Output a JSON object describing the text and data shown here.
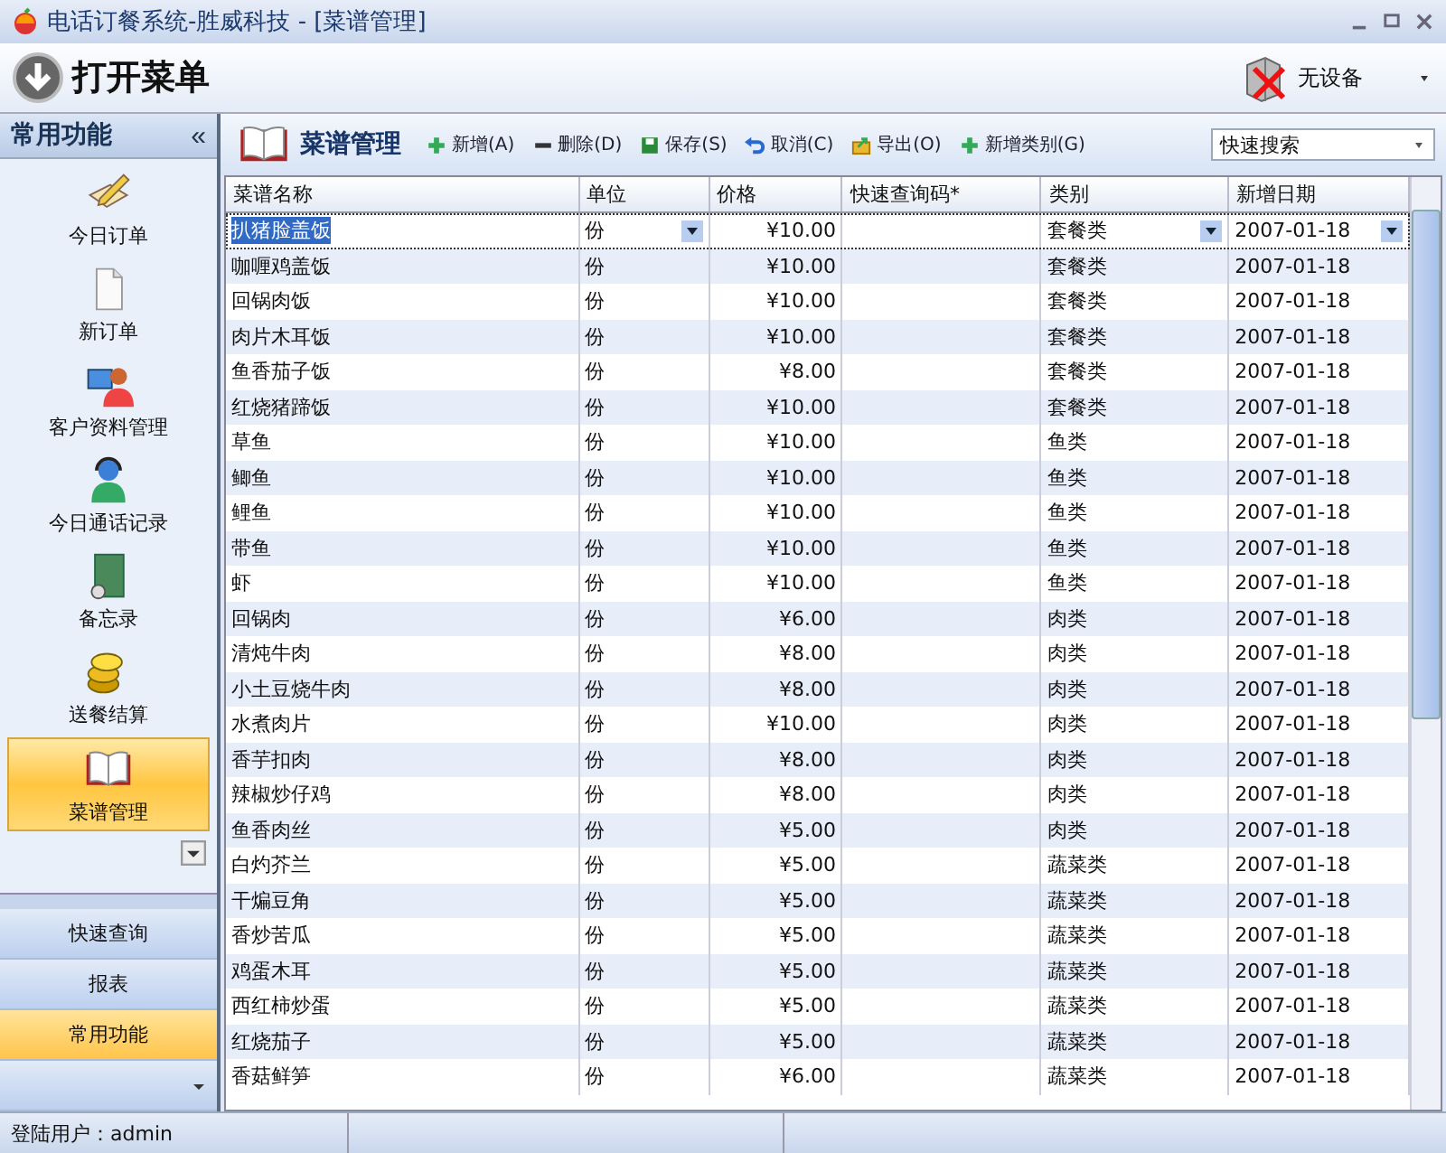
{
  "window": {
    "title": "电话订餐系统-胜威科技 - [菜谱管理]"
  },
  "ribbon": {
    "menu_button": "打开菜单",
    "device": "无设备"
  },
  "sidebar": {
    "title": "常用功能",
    "collapse": "«",
    "items": [
      {
        "label": "今日订单",
        "kind": "notepad",
        "selected": false
      },
      {
        "label": "新订单",
        "kind": "page",
        "selected": false
      },
      {
        "label": "客户资料管理",
        "kind": "people",
        "selected": false
      },
      {
        "label": "今日通话记录",
        "kind": "phone",
        "selected": false
      },
      {
        "label": "备忘录",
        "kind": "memo",
        "selected": false
      },
      {
        "label": "送餐结算",
        "kind": "coins",
        "selected": false
      },
      {
        "label": "菜谱管理",
        "kind": "book",
        "selected": true
      }
    ],
    "groups": [
      {
        "label": "快速查询",
        "selected": false
      },
      {
        "label": "报表",
        "selected": false
      },
      {
        "label": "常用功能",
        "selected": true
      }
    ]
  },
  "panel": {
    "title": "菜谱管理",
    "toolbar": [
      {
        "label": "新增(A)",
        "kind": "plus"
      },
      {
        "label": "删除(D)",
        "kind": "minus"
      },
      {
        "label": "保存(S)",
        "kind": "save"
      },
      {
        "label": "取消(C)",
        "kind": "undo"
      },
      {
        "label": "导出(O)",
        "kind": "export"
      },
      {
        "label": "新增类别(G)",
        "kind": "plus"
      }
    ],
    "search": {
      "value": "快速搜索"
    }
  },
  "table": {
    "columns": [
      "菜谱名称",
      "单位",
      "价格",
      "快速查询码*",
      "类别",
      "新增日期"
    ],
    "rows": [
      {
        "name": "扒猪脸盖饭",
        "unit": "份",
        "price": "¥10.00",
        "category": "套餐类",
        "date": "2007-01-18",
        "selected": true
      },
      {
        "name": "咖喱鸡盖饭",
        "unit": "份",
        "price": "¥10.00",
        "category": "套餐类",
        "date": "2007-01-18",
        "selected": false
      },
      {
        "name": "回锅肉饭",
        "unit": "份",
        "price": "¥10.00",
        "category": "套餐类",
        "date": "2007-01-18",
        "selected": false
      },
      {
        "name": "肉片木耳饭",
        "unit": "份",
        "price": "¥10.00",
        "category": "套餐类",
        "date": "2007-01-18",
        "selected": false
      },
      {
        "name": "鱼香茄子饭",
        "unit": "份",
        "price": "¥8.00",
        "category": "套餐类",
        "date": "2007-01-18",
        "selected": false
      },
      {
        "name": "红烧猪蹄饭",
        "unit": "份",
        "price": "¥10.00",
        "category": "套餐类",
        "date": "2007-01-18",
        "selected": false
      },
      {
        "name": "草鱼",
        "unit": "份",
        "price": "¥10.00",
        "category": "鱼类",
        "date": "2007-01-18",
        "selected": false
      },
      {
        "name": "鲫鱼",
        "unit": "份",
        "price": "¥10.00",
        "category": "鱼类",
        "date": "2007-01-18",
        "selected": false
      },
      {
        "name": "鲤鱼",
        "unit": "份",
        "price": "¥10.00",
        "category": "鱼类",
        "date": "2007-01-18",
        "selected": false
      },
      {
        "name": "带鱼",
        "unit": "份",
        "price": "¥10.00",
        "category": "鱼类",
        "date": "2007-01-18",
        "selected": false
      },
      {
        "name": "虾",
        "unit": "份",
        "price": "¥10.00",
        "category": "鱼类",
        "date": "2007-01-18",
        "selected": false
      },
      {
        "name": "回锅肉",
        "unit": "份",
        "price": "¥6.00",
        "category": "肉类",
        "date": "2007-01-18",
        "selected": false
      },
      {
        "name": "清炖牛肉",
        "unit": "份",
        "price": "¥8.00",
        "category": "肉类",
        "date": "2007-01-18",
        "selected": false
      },
      {
        "name": "小土豆烧牛肉",
        "unit": "份",
        "price": "¥8.00",
        "category": "肉类",
        "date": "2007-01-18",
        "selected": false
      },
      {
        "name": "水煮肉片",
        "unit": "份",
        "price": "¥10.00",
        "category": "肉类",
        "date": "2007-01-18",
        "selected": false
      },
      {
        "name": "香芋扣肉",
        "unit": "份",
        "price": "¥8.00",
        "category": "肉类",
        "date": "2007-01-18",
        "selected": false
      },
      {
        "name": "辣椒炒仔鸡",
        "unit": "份",
        "price": "¥8.00",
        "category": "肉类",
        "date": "2007-01-18",
        "selected": false
      },
      {
        "name": "鱼香肉丝",
        "unit": "份",
        "price": "¥5.00",
        "category": "肉类",
        "date": "2007-01-18",
        "selected": false
      },
      {
        "name": "白灼芥兰",
        "unit": "份",
        "price": "¥5.00",
        "category": "蔬菜类",
        "date": "2007-01-18",
        "selected": false
      },
      {
        "name": "干煸豆角",
        "unit": "份",
        "price": "¥5.00",
        "category": "蔬菜类",
        "date": "2007-01-18",
        "selected": false
      },
      {
        "name": "香炒苦瓜",
        "unit": "份",
        "price": "¥5.00",
        "category": "蔬菜类",
        "date": "2007-01-18",
        "selected": false
      },
      {
        "name": "鸡蛋木耳",
        "unit": "份",
        "price": "¥5.00",
        "category": "蔬菜类",
        "date": "2007-01-18",
        "selected": false
      },
      {
        "name": "西红柿炒蛋",
        "unit": "份",
        "price": "¥5.00",
        "category": "蔬菜类",
        "date": "2007-01-18",
        "selected": false
      },
      {
        "name": "红烧茄子",
        "unit": "份",
        "price": "¥5.00",
        "category": "蔬菜类",
        "date": "2007-01-18",
        "selected": false
      },
      {
        "name": "香菇鲜笋",
        "unit": "份",
        "price": "¥6.00",
        "category": "蔬菜类",
        "date": "2007-01-18",
        "selected": false
      }
    ]
  },
  "status_bar": {
    "user": "登陆用户：admin"
  }
}
